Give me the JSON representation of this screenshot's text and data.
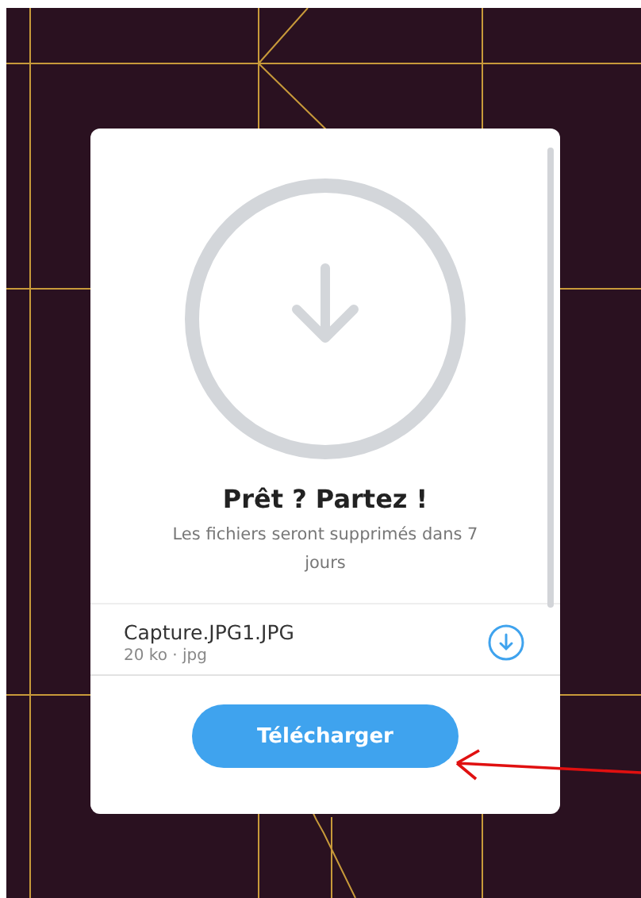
{
  "dialog": {
    "title": "Prêt ? Partez !",
    "message": "Les fichiers seront supprimés dans 7 jours",
    "files": [
      {
        "name": "Capture.JPG1.JPG",
        "meta": "20 ko · jpg"
      }
    ],
    "button": {
      "label": "Télécharger"
    }
  }
}
